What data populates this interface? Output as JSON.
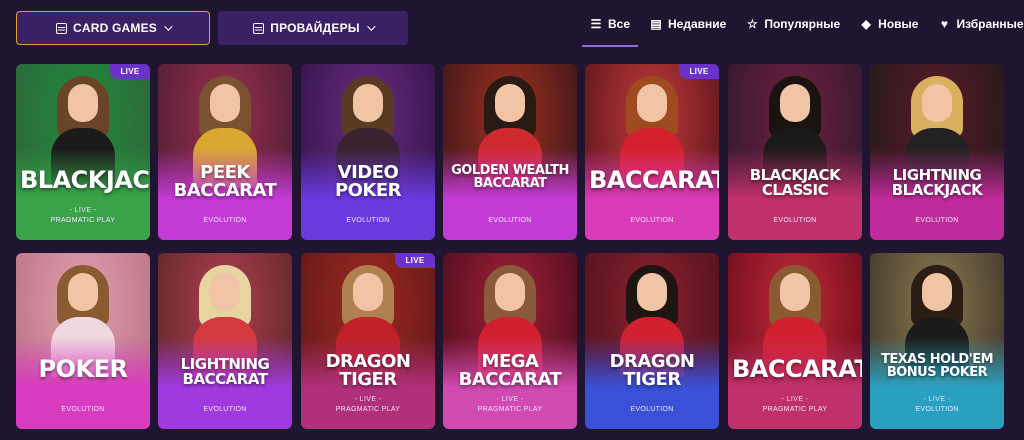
{
  "topbar": {
    "category_dropdown": "CARD GAMES",
    "providers_dropdown": "ПРОВАЙДЕРЫ",
    "filters": [
      {
        "label": "Все",
        "icon": "list-icon",
        "active": true
      },
      {
        "label": "Недавние",
        "icon": "recent-icon",
        "active": false
      },
      {
        "label": "Популярные",
        "icon": "star-icon",
        "active": false
      },
      {
        "label": "Новые",
        "icon": "diamond-icon",
        "active": false
      },
      {
        "label": "Избранные",
        "icon": "heart-icon",
        "active": false
      }
    ]
  },
  "games": [
    {
      "title": "BLACKJACK",
      "sub": "- LIVE -",
      "provider": "PRAGMATIC PLAY",
      "live": true,
      "bg": "#2c6a3a",
      "accent": "#1f8a3c",
      "fade": "#3aa34a",
      "hair": "#6a4426",
      "dress": "#1a1a1a"
    },
    {
      "title": "PEEK BACCARAT",
      "sub": "",
      "provider": "EVOLUTION",
      "live": false,
      "bg": "#5a2038",
      "accent": "#9a3050",
      "fade": "#c43ad6",
      "hair": "#7a5232",
      "dress": "#d8a830"
    },
    {
      "title": "VIDEO POKER",
      "sub": "",
      "provider": "EVOLUTION",
      "live": false,
      "bg": "#3a1850",
      "accent": "#6a2a80",
      "fade": "#6a3ae0",
      "hair": "#5a3a22",
      "dress": "#3a2230"
    },
    {
      "title": "GOLDEN WEALTH BACCARAT",
      "sub": "",
      "provider": "EVOLUTION",
      "live": false,
      "bg": "#4a1a1a",
      "accent": "#a03020",
      "fade": "#c43ad6",
      "hair": "#2a1a14",
      "dress": "#d02a30"
    },
    {
      "title": "BACCARAT",
      "sub": "",
      "provider": "EVOLUTION",
      "live": true,
      "bg": "#6a1a20",
      "accent": "#c03a3a",
      "fade": "#d83ab8",
      "hair": "#a04a22",
      "dress": "#d4202c"
    },
    {
      "title": "BLACKJACK CLASSIC",
      "sub": "",
      "provider": "EVOLUTION",
      "live": false,
      "bg": "#3a1a30",
      "accent": "#702040",
      "fade": "#c0306a",
      "hair": "#1a1410",
      "dress": "#1a1a1a"
    },
    {
      "title": "LIGHTNING BLACKJACK",
      "sub": "",
      "provider": "EVOLUTION",
      "live": false,
      "bg": "#2a1a1a",
      "accent": "#5a1a2a",
      "fade": "#c02a9a",
      "hair": "#d8b060",
      "dress": "#222222"
    },
    {
      "title": "POKER",
      "sub": "",
      "provider": "EVOLUTION",
      "live": false,
      "bg": "#c07a8a",
      "accent": "#e0a0b0",
      "fade": "#d83ac0",
      "hair": "#8a5a32",
      "dress": "#f0d8e0"
    },
    {
      "title": "LIGHTNING BACCARAT",
      "sub": "",
      "provider": "EVOLUTION",
      "live": false,
      "bg": "#6a2a30",
      "accent": "#b04050",
      "fade": "#a03ae0",
      "hair": "#e8d4a0",
      "dress": "#d43a40"
    },
    {
      "title": "DRAGON TIGER",
      "sub": "- LIVE -",
      "provider": "PRAGMATIC PLAY",
      "live": true,
      "bg": "#6a1a1a",
      "accent": "#a02a22",
      "fade": "#b0307a",
      "hair": "#b08050",
      "dress": "#c0202a"
    },
    {
      "title": "MEGA BACCARAT",
      "sub": "- LIVE -",
      "provider": "PRAGMATIC PLAY",
      "live": false,
      "bg": "#5a1020",
      "accent": "#a02038",
      "fade": "#d04ab0",
      "hair": "#8a5a3a",
      "dress": "#d02030"
    },
    {
      "title": "DRAGON TIGER",
      "sub": "",
      "provider": "EVOLUTION",
      "live": false,
      "bg": "#5a1420",
      "accent": "#8a2030",
      "fade": "#3a50d8",
      "hair": "#1e1410",
      "dress": "#d02030"
    },
    {
      "title": "BACCARAT",
      "sub": "- LIVE -",
      "provider": "PRAGMATIC PLAY",
      "live": false,
      "bg": "#7a1020",
      "accent": "#c02a38",
      "fade": "#c0306a",
      "hair": "#8a5a32",
      "dress": "#d02030"
    },
    {
      "title": "TEXAS HOLD'EM BONUS POKER",
      "sub": "- LIVE -",
      "provider": "EVOLUTION",
      "live": false,
      "bg": "#4a4030",
      "accent": "#8a7a50",
      "fade": "#2aa0c0",
      "hair": "#2a1e14",
      "dress": "#1a1a1a"
    }
  ]
}
